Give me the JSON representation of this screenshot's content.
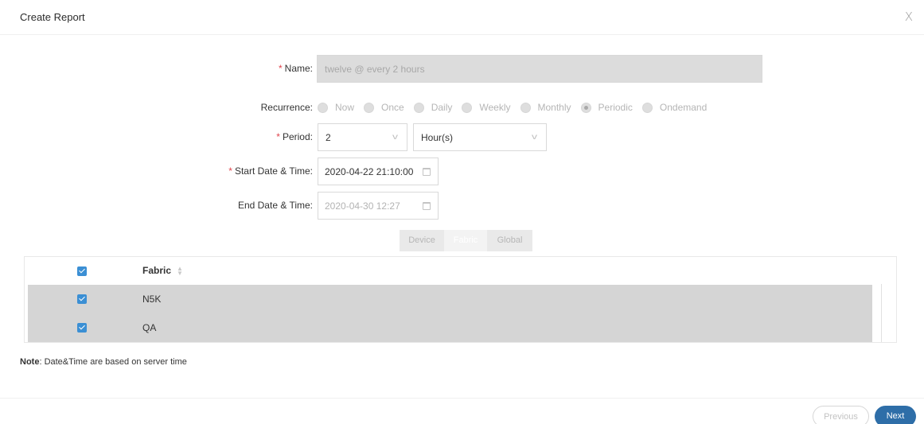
{
  "dialog": {
    "title": "Create Report",
    "close_label": "X"
  },
  "form": {
    "name": {
      "label": "Name:",
      "value": "twelve @ every 2 hours",
      "required": true
    },
    "recurrence": {
      "label": "Recurrence:",
      "options": [
        "Now",
        "Once",
        "Daily",
        "Weekly",
        "Monthly",
        "Periodic",
        "Ondemand"
      ],
      "selected": "Periodic"
    },
    "period": {
      "label": "Period:",
      "value": "2",
      "unit": "Hour(s)",
      "required": true
    },
    "start": {
      "label": "Start Date & Time:",
      "value": "2020-04-22 21:10:00",
      "required": true
    },
    "end": {
      "label": "End Date & Time:",
      "value": "2020-04-30 12:27"
    }
  },
  "scope_tabs": {
    "options": [
      "Device",
      "Fabric",
      "Global"
    ],
    "selected": "Fabric"
  },
  "table": {
    "header": "Fabric",
    "header_checked": true,
    "rows": [
      {
        "name": "N5K",
        "checked": true
      },
      {
        "name": "QA",
        "checked": true
      }
    ]
  },
  "note": {
    "label": "Note",
    "text": ": Date&Time are based on server time"
  },
  "footer": {
    "previous_label": "Previous",
    "next_label": "Next"
  },
  "colors": {
    "primary": "#2e6ea8",
    "checkbox": "#3b8fd4",
    "required": "#e0434b",
    "row_selected": "#d5d5d5"
  }
}
